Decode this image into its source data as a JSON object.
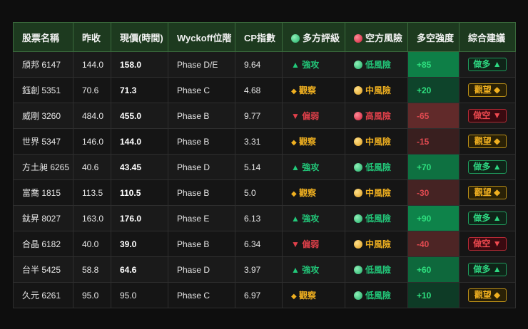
{
  "headers": [
    "股票名稱",
    "昨收",
    "現價(時間)",
    "Wyckoff位階",
    "CP指數",
    "多方評級",
    "空方風險",
    "多空強度",
    "綜合建議"
  ],
  "colors": {
    "green": "#22c97a",
    "yellow": "#f0b020",
    "red": "#e0404a",
    "header_bg": "#1d3a1f"
  },
  "rows": [
    {
      "name": "頎邦 6147",
      "prev": "144.0",
      "price": "158.0",
      "price_bold": true,
      "phase": "Phase D/E",
      "cp": "9.64",
      "rating": "強攻",
      "rating_icon": "▲",
      "rating_tone": "g",
      "risk": "低風險",
      "risk_tone": "g",
      "strength": 85,
      "strength_label": "+85",
      "advice": "做多 ▲",
      "advice_tone": "g"
    },
    {
      "name": "鈺創 5351",
      "prev": "70.6",
      "price": "71.3",
      "price_bold": true,
      "phase": "Phase C",
      "cp": "4.68",
      "rating": "觀察",
      "rating_icon": "◆",
      "rating_tone": "y",
      "risk": "中風險",
      "risk_tone": "y",
      "strength": 20,
      "strength_label": "+20",
      "advice": "觀望 ◆",
      "advice_tone": "y"
    },
    {
      "name": "威剛 3260",
      "prev": "484.0",
      "price": "455.0",
      "price_bold": true,
      "phase": "Phase B",
      "cp": "9.77",
      "rating": "偏弱",
      "rating_icon": "▼",
      "rating_tone": "r",
      "risk": "高風險",
      "risk_tone": "r",
      "strength": -65,
      "strength_label": "-65",
      "advice": "做空 ▼",
      "advice_tone": "r"
    },
    {
      "name": "世界 5347",
      "prev": "146.0",
      "price": "144.0",
      "price_bold": true,
      "phase": "Phase B",
      "cp": "3.31",
      "rating": "觀察",
      "rating_icon": "◆",
      "rating_tone": "y",
      "risk": "中風險",
      "risk_tone": "y",
      "strength": -15,
      "strength_label": "-15",
      "advice": "觀望 ◆",
      "advice_tone": "y"
    },
    {
      "name": "方土昶 6265",
      "prev": "40.6",
      "price": "43.45",
      "price_bold": true,
      "phase": "Phase D",
      "cp": "5.14",
      "rating": "強攻",
      "rating_icon": "▲",
      "rating_tone": "g",
      "risk": "低風險",
      "risk_tone": "g",
      "strength": 70,
      "strength_label": "+70",
      "advice": "做多 ▲",
      "advice_tone": "g"
    },
    {
      "name": "富喬 1815",
      "prev": "113.5",
      "price": "110.5",
      "price_bold": true,
      "phase": "Phase B",
      "cp": "5.0",
      "rating": "觀察",
      "rating_icon": "◆",
      "rating_tone": "y",
      "risk": "中風險",
      "risk_tone": "y",
      "strength": -30,
      "strength_label": "-30",
      "advice": "觀望 ◆",
      "advice_tone": "y"
    },
    {
      "name": "鈦昇 8027",
      "prev": "163.0",
      "price": "176.0",
      "price_bold": true,
      "phase": "Phase E",
      "cp": "6.13",
      "rating": "強攻",
      "rating_icon": "▲",
      "rating_tone": "g",
      "risk": "低風險",
      "risk_tone": "g",
      "strength": 90,
      "strength_label": "+90",
      "advice": "做多 ▲",
      "advice_tone": "g"
    },
    {
      "name": "合晶 6182",
      "prev": "40.0",
      "price": "39.0",
      "price_bold": true,
      "phase": "Phase B",
      "cp": "6.34",
      "rating": "偏弱",
      "rating_icon": "▼",
      "rating_tone": "r",
      "risk": "中風險",
      "risk_tone": "y",
      "strength": -40,
      "strength_label": "-40",
      "advice": "做空 ▼",
      "advice_tone": "r"
    },
    {
      "name": "台半 5425",
      "prev": "58.8",
      "price": "64.6",
      "price_bold": true,
      "phase": "Phase D",
      "cp": "3.97",
      "rating": "強攻",
      "rating_icon": "▲",
      "rating_tone": "g",
      "risk": "低風險",
      "risk_tone": "g",
      "strength": 60,
      "strength_label": "+60",
      "advice": "做多 ▲",
      "advice_tone": "g"
    },
    {
      "name": "久元 6261",
      "prev": "95.0",
      "price": "95.0",
      "price_bold": false,
      "phase": "Phase C",
      "cp": "6.97",
      "rating": "觀察",
      "rating_icon": "◆",
      "rating_tone": "y",
      "risk": "低風險",
      "risk_tone": "g",
      "strength": 10,
      "strength_label": "+10",
      "advice": "觀望 ◆",
      "advice_tone": "y"
    }
  ]
}
